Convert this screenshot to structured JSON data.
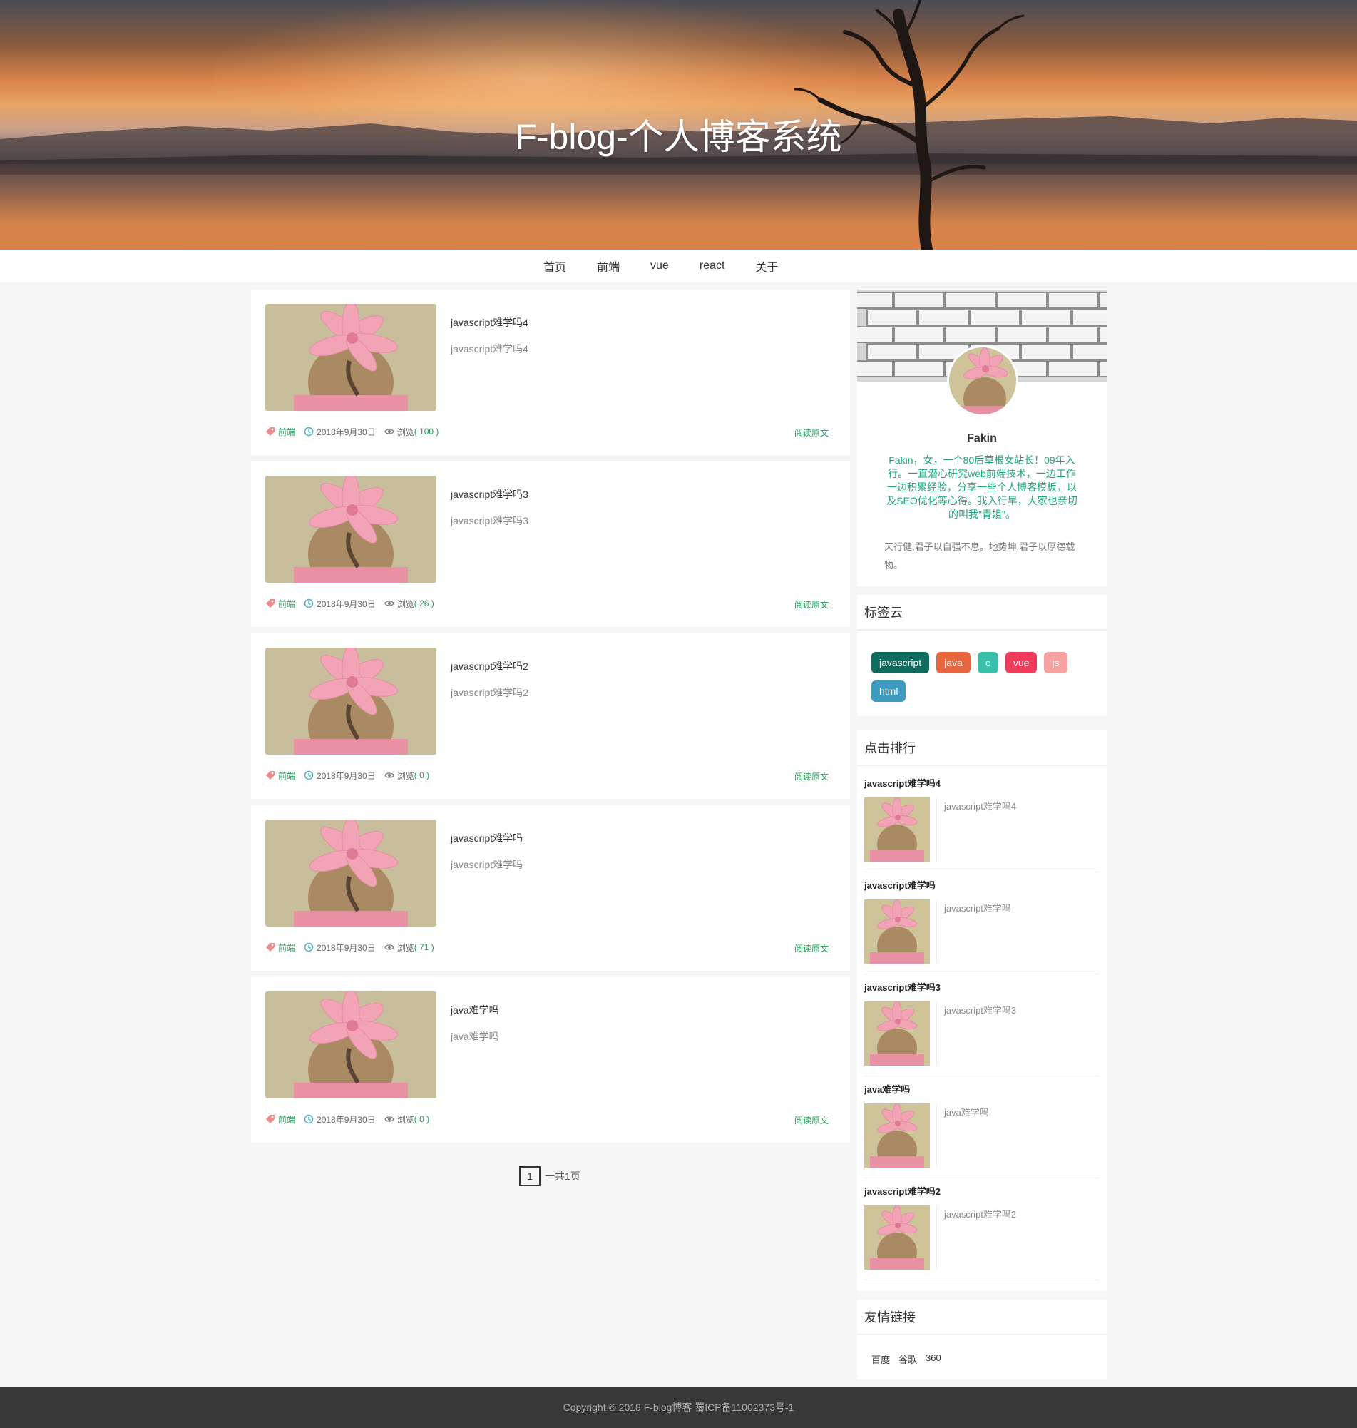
{
  "site": {
    "title": "F-blog-个人博客系统"
  },
  "nav": {
    "items": [
      "首页",
      "前端",
      "vue",
      "react",
      "关于"
    ]
  },
  "articles": [
    {
      "title": "javascript难学吗4",
      "summary": "javascript难学吗4",
      "tag": "前端",
      "date": "2018年9月30日",
      "views_label": "浏览",
      "views": "( 100 )",
      "read_more": "阅读原文"
    },
    {
      "title": "javascript难学吗3",
      "summary": "javascript难学吗3",
      "tag": "前端",
      "date": "2018年9月30日",
      "views_label": "浏览",
      "views": "( 26 )",
      "read_more": "阅读原文"
    },
    {
      "title": "javascript难学吗2",
      "summary": "javascript难学吗2",
      "tag": "前端",
      "date": "2018年9月30日",
      "views_label": "浏览",
      "views": "( 0 )",
      "read_more": "阅读原文"
    },
    {
      "title": "javascript难学吗",
      "summary": "javascript难学吗",
      "tag": "前端",
      "date": "2018年9月30日",
      "views_label": "浏览",
      "views": "( 71 )",
      "read_more": "阅读原文"
    },
    {
      "title": "java难学吗",
      "summary": "java难学吗",
      "tag": "前端",
      "date": "2018年9月30日",
      "views_label": "浏览",
      "views": "( 0 )",
      "read_more": "阅读原文"
    }
  ],
  "pager": {
    "current": "1",
    "total_text": "一共1页"
  },
  "profile": {
    "name": "Fakin",
    "intro": "Fakin，女，一个80后草根女站长！09年入行。一直潜心研究web前端技术，一边工作一边积累经验，分享一些个人博客模板，以及SEO优化等心得。我入行早，大家也亲切的叫我\"青姐\"。",
    "quote": "天行健,君子以自强不息。地势坤,君子以厚德载物。"
  },
  "tag_cloud": {
    "title": "标签云",
    "tags": [
      {
        "label": "javascript",
        "color": "#0e6b5e"
      },
      {
        "label": "java",
        "color": "#e8663d"
      },
      {
        "label": "c",
        "color": "#3bbfad"
      },
      {
        "label": "vue",
        "color": "#f03c5a"
      },
      {
        "label": "js",
        "color": "#f7a1a1"
      },
      {
        "label": "html",
        "color": "#3c9bbf"
      }
    ]
  },
  "ranking": {
    "title": "点击排行",
    "items": [
      {
        "title": "javascript难学吗4",
        "summary": "javascript难学吗4"
      },
      {
        "title": "javascript难学吗",
        "summary": "javascript难学吗"
      },
      {
        "title": "javascript难学吗3",
        "summary": "javascript难学吗3"
      },
      {
        "title": "java难学吗",
        "summary": "java难学吗"
      },
      {
        "title": "javascript难学吗2",
        "summary": "javascript难学吗2"
      }
    ]
  },
  "friend_links": {
    "title": "友情链接",
    "items": [
      "百度",
      "谷歌",
      "360"
    ]
  },
  "footer": {
    "text": "Copyright © 2018 F-blog博客 蜀ICP备11002373号-1"
  },
  "colors": {
    "accent_green": "#1f9d55",
    "intro_green": "#1fa67a",
    "footer_bg": "#383838"
  }
}
